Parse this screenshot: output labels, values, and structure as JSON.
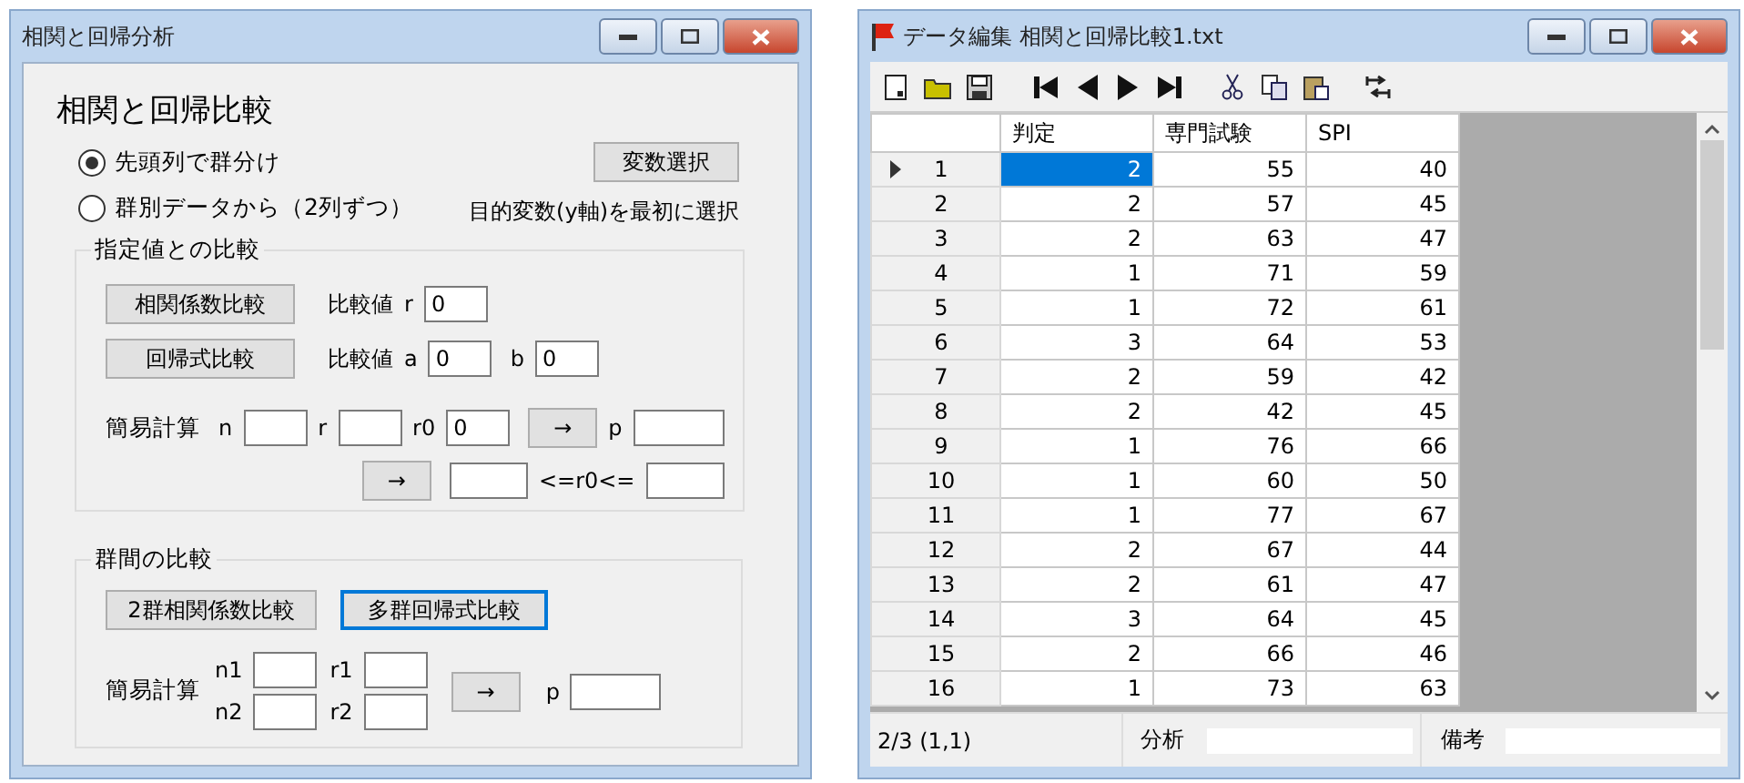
{
  "analysis_window": {
    "title": "相関と回帰分析",
    "heading": "相関と回帰比較",
    "grouping": [
      {
        "label": "先頭列で群分け",
        "selected": true
      },
      {
        "label": "群別データから（2列ずつ）",
        "selected": false
      }
    ],
    "select_button": "変数選択",
    "note": "目的変数(y軸)を最初に選択",
    "fixed_value_group": {
      "title": "指定値との比較",
      "corr_button": "相関係数比較",
      "corr_label": "比較値",
      "r_label": "r",
      "r_value": "0",
      "regression_button": "回帰式比較",
      "regression_label": "比較値",
      "a_label": "a",
      "a_value": "0",
      "b_label": "b",
      "b_value": "0",
      "calc_label": "簡易計算",
      "n_label": "n",
      "r_label_2": "r",
      "r0_label": "r0",
      "r0_value": "0",
      "arrow_button": "→",
      "p_label": "p",
      "arrow_button_2": "→",
      "range_label": "<=r0<="
    },
    "between_groups": {
      "title": "群間の比較",
      "buttons": [
        {
          "label": "2群相関係数比較",
          "focused": false
        },
        {
          "label": "多群回帰式比較",
          "focused": true
        }
      ],
      "calc_label": "簡易計算",
      "n1_label": "n1",
      "r1_label": "r1",
      "n2_label": "n2",
      "r2_label": "r2",
      "arrow_button": "→",
      "p_label": "p"
    }
  },
  "data_window": {
    "title": "データ編集 相関と回帰比較1.txt",
    "columns": [
      "判定",
      "専門試験",
      "SPI"
    ],
    "rows": [
      {
        "number": "1",
        "current": true,
        "cells": [
          {
            "value": "2",
            "selected": true
          },
          {
            "value": "55",
            "selected": false
          },
          {
            "value": "40",
            "selected": false
          }
        ]
      },
      {
        "number": "2",
        "current": false,
        "cells": [
          {
            "value": "2",
            "selected": false
          },
          {
            "value": "57",
            "selected": false
          },
          {
            "value": "45",
            "selected": false
          }
        ]
      },
      {
        "number": "3",
        "current": false,
        "cells": [
          {
            "value": "2",
            "selected": false
          },
          {
            "value": "63",
            "selected": false
          },
          {
            "value": "47",
            "selected": false
          }
        ]
      },
      {
        "number": "4",
        "current": false,
        "cells": [
          {
            "value": "1",
            "selected": false
          },
          {
            "value": "71",
            "selected": false
          },
          {
            "value": "59",
            "selected": false
          }
        ]
      },
      {
        "number": "5",
        "current": false,
        "cells": [
          {
            "value": "1",
            "selected": false
          },
          {
            "value": "72",
            "selected": false
          },
          {
            "value": "61",
            "selected": false
          }
        ]
      },
      {
        "number": "6",
        "current": false,
        "cells": [
          {
            "value": "3",
            "selected": false
          },
          {
            "value": "64",
            "selected": false
          },
          {
            "value": "53",
            "selected": false
          }
        ]
      },
      {
        "number": "7",
        "current": false,
        "cells": [
          {
            "value": "2",
            "selected": false
          },
          {
            "value": "59",
            "selected": false
          },
          {
            "value": "42",
            "selected": false
          }
        ]
      },
      {
        "number": "8",
        "current": false,
        "cells": [
          {
            "value": "2",
            "selected": false
          },
          {
            "value": "42",
            "selected": false
          },
          {
            "value": "45",
            "selected": false
          }
        ]
      },
      {
        "number": "9",
        "current": false,
        "cells": [
          {
            "value": "1",
            "selected": false
          },
          {
            "value": "76",
            "selected": false
          },
          {
            "value": "66",
            "selected": false
          }
        ]
      },
      {
        "number": "10",
        "current": false,
        "cells": [
          {
            "value": "1",
            "selected": false
          },
          {
            "value": "60",
            "selected": false
          },
          {
            "value": "50",
            "selected": false
          }
        ]
      },
      {
        "number": "11",
        "current": false,
        "cells": [
          {
            "value": "1",
            "selected": false
          },
          {
            "value": "77",
            "selected": false
          },
          {
            "value": "67",
            "selected": false
          }
        ]
      },
      {
        "number": "12",
        "current": false,
        "cells": [
          {
            "value": "2",
            "selected": false
          },
          {
            "value": "67",
            "selected": false
          },
          {
            "value": "44",
            "selected": false
          }
        ]
      },
      {
        "number": "13",
        "current": false,
        "cells": [
          {
            "value": "2",
            "selected": false
          },
          {
            "value": "61",
            "selected": false
          },
          {
            "value": "47",
            "selected": false
          }
        ]
      },
      {
        "number": "14",
        "current": false,
        "cells": [
          {
            "value": "3",
            "selected": false
          },
          {
            "value": "64",
            "selected": false
          },
          {
            "value": "45",
            "selected": false
          }
        ]
      },
      {
        "number": "15",
        "current": false,
        "cells": [
          {
            "value": "2",
            "selected": false
          },
          {
            "value": "66",
            "selected": false
          },
          {
            "value": "46",
            "selected": false
          }
        ]
      },
      {
        "number": "16",
        "current": false,
        "cells": [
          {
            "value": "1",
            "selected": false
          },
          {
            "value": "73",
            "selected": false
          },
          {
            "value": "63",
            "selected": false
          }
        ]
      }
    ],
    "status_bar": {
      "position": "2/3 (1,1)",
      "analysis_label": "分析",
      "remarks_label": "備考"
    }
  }
}
